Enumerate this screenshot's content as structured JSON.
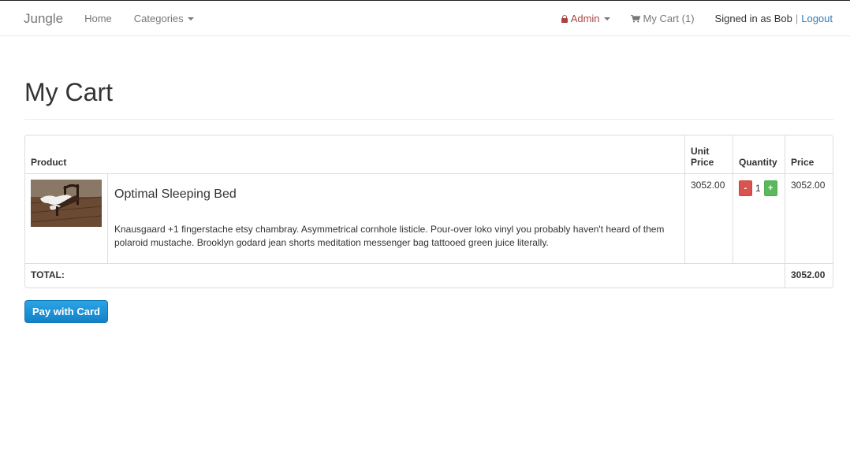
{
  "nav": {
    "brand": "Jungle",
    "home": "Home",
    "categories": "Categories",
    "admin": "Admin",
    "cart": "My Cart (1)",
    "signed_in": "Signed in as Bob",
    "separator": "|",
    "logout": "Logout"
  },
  "page": {
    "title": "My Cart"
  },
  "table": {
    "headers": {
      "product": "Product",
      "unit_price": "Unit Price",
      "quantity": "Quantity",
      "price": "Price"
    },
    "items": [
      {
        "name": "Optimal Sleeping Bed",
        "description": "Knausgaard +1 fingerstache etsy chambray. Asymmetrical cornhole listicle. Pour-over loko vinyl you probably haven't heard of them polaroid mustache. Brooklyn godard jean shorts meditation messenger bag tattooed green juice literally.",
        "unit_price": "3052.00",
        "quantity": "1",
        "price": "3052.00",
        "minus_label": "-",
        "plus_label": "+"
      }
    ],
    "total_label": "TOTAL:",
    "total_value": "3052.00"
  },
  "pay_button": "Pay with Card",
  "colors": {
    "admin": "#a94442",
    "link": "#337ab7",
    "minus": "#d9534f",
    "plus": "#5cb85c",
    "pay": "#1e93d8"
  },
  "icons": {
    "admin": "lock-icon",
    "cart": "shopping-cart-icon"
  }
}
